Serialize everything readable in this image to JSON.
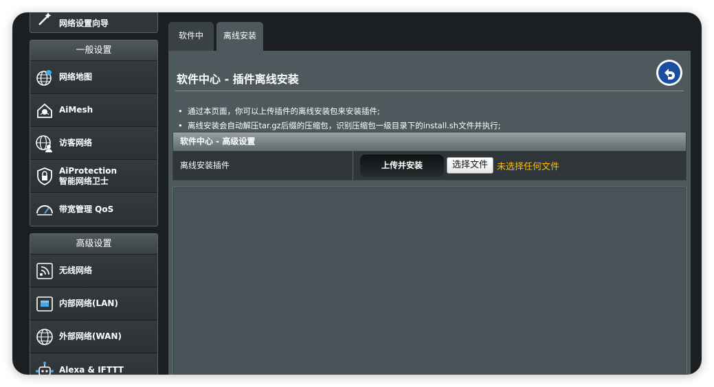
{
  "sidebar": {
    "top_item": {
      "label": "网络设置向导",
      "icon": "wizard-icon"
    },
    "general": {
      "title": "一般设置",
      "items": [
        {
          "label": "网络地图",
          "icon": "network-map-icon"
        },
        {
          "label": "AiMesh",
          "icon": "aimesh-icon"
        },
        {
          "label": "访客网络",
          "icon": "guest-network-icon"
        },
        {
          "label": "AiProtection",
          "label2": "智能网络卫士",
          "icon": "shield-icon"
        },
        {
          "label": "带宽管理 QoS",
          "icon": "speedometer-icon"
        }
      ]
    },
    "advanced": {
      "title": "高级设置",
      "items": [
        {
          "label": "无线网络",
          "icon": "wireless-icon"
        },
        {
          "label": "内部网络(LAN)",
          "icon": "lan-icon"
        },
        {
          "label": "外部网络(WAN)",
          "icon": "globe-icon"
        },
        {
          "label": "Alexa & IFTTT",
          "icon": "robot-icon"
        }
      ]
    }
  },
  "tabs": [
    {
      "label": "软件中心",
      "active": false
    },
    {
      "label": "离线安装",
      "active": true
    }
  ],
  "main": {
    "title": "软件中心 - 插件离线安装",
    "notes": [
      "通过本页面，你可以上传插件的离线安装包来安装插件;",
      "离线安装会自动解压tar.gz后缀的压缩包，识别压缩包一级目录下的install.sh文件并执行;"
    ],
    "settings": {
      "header": "软件中心 - 高级设置",
      "row_label": "离线安装插件",
      "upload_button": "上传并安装",
      "file_button": "选择文件",
      "file_status": "未选择任何文件"
    }
  },
  "colors": {
    "background": "#1c1f21",
    "panel": "#4d595d",
    "accent": "#ffc000"
  }
}
